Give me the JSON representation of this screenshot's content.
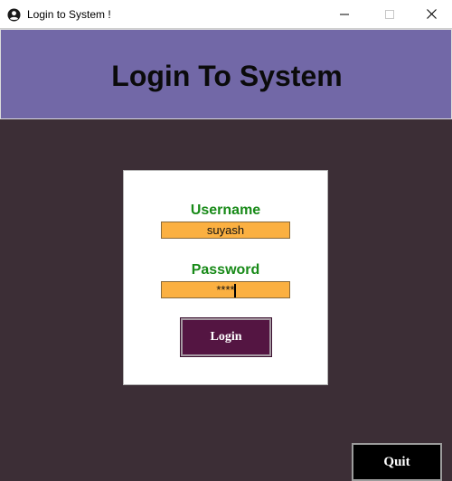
{
  "window": {
    "title": "Login to System !",
    "icon": "user-circle-icon",
    "controls": [
      "minimize-icon",
      "maximize-icon",
      "close-icon"
    ]
  },
  "header": {
    "title": "Login To System",
    "background": "#7268a7"
  },
  "form": {
    "username_label": "Username",
    "username_value": "suyash",
    "password_label": "Password",
    "password_value": "****",
    "login_label": "Login"
  },
  "quit_label": "Quit",
  "colors": {
    "background": "#3c2e36",
    "label_green": "#188a18",
    "input_fill": "#fbb041",
    "login_button": "#541542",
    "quit_button": "#000000"
  }
}
